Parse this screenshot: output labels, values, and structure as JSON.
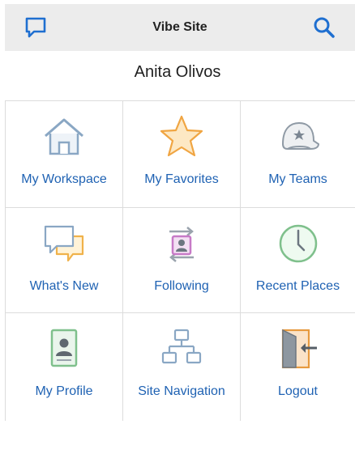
{
  "header": {
    "title": "Vibe Site"
  },
  "user": {
    "name": "Anita Olivos"
  },
  "tiles": [
    {
      "label": "My Workspace",
      "icon": "home-icon"
    },
    {
      "label": "My Favorites",
      "icon": "star-icon"
    },
    {
      "label": "My Teams",
      "icon": "team-cap-icon"
    },
    {
      "label": "What's New",
      "icon": "chat-bubbles-icon"
    },
    {
      "label": "Following",
      "icon": "following-icon"
    },
    {
      "label": "Recent Places",
      "icon": "clock-icon"
    },
    {
      "label": "My Profile",
      "icon": "profile-card-icon"
    },
    {
      "label": "Site Navigation",
      "icon": "sitemap-icon"
    },
    {
      "label": "Logout",
      "icon": "logout-door-icon"
    }
  ],
  "colors": {
    "accent": "#1f62b3",
    "header_bg": "#ececec",
    "divider": "#dcdcdc"
  }
}
